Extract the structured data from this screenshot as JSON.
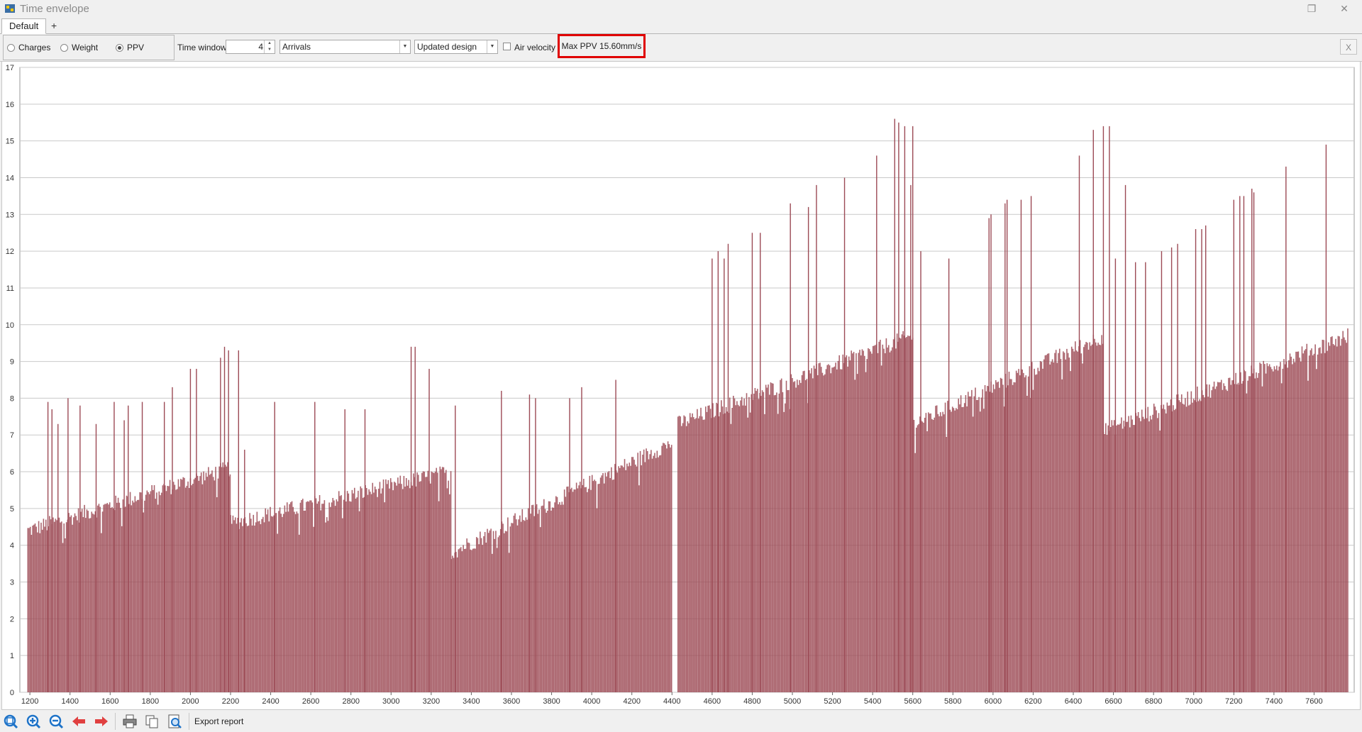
{
  "window": {
    "title": "Time envelope"
  },
  "tabs": [
    {
      "label": "Default"
    },
    {
      "label": "+"
    }
  ],
  "toolbar": {
    "radio_options": [
      {
        "label": "Charges",
        "checked": false
      },
      {
        "label": "Weight",
        "checked": false
      },
      {
        "label": "PPV",
        "checked": true
      }
    ],
    "time_window_label": "Time window",
    "time_window_value": "4",
    "source_select": "Arrivals",
    "design_select": "Updated design",
    "air_velocity_label": "Air velocity",
    "air_velocity_checked": false,
    "max_ppv": "Max PPV 15.60mm/s",
    "close_label": "X"
  },
  "bottom": {
    "export_label": "Export report"
  },
  "colors": {
    "bar": "#9c4a55",
    "highlight": "#e00000"
  },
  "icons": [
    "zoom-fit-icon",
    "zoom-in-icon",
    "zoom-out-icon",
    "arrow-left-icon",
    "arrow-right-icon",
    "print-icon",
    "copy-icon",
    "print-preview-icon"
  ],
  "chart_data": {
    "type": "bar",
    "xlim": [
      1150,
      7800
    ],
    "ylim": [
      0,
      17
    ],
    "x_ticks": [
      1200,
      1400,
      1600,
      1800,
      2000,
      2200,
      2400,
      2600,
      2800,
      3000,
      3200,
      3400,
      3600,
      3800,
      4000,
      4200,
      4400,
      4600,
      4800,
      5000,
      5200,
      5400,
      5600,
      5800,
      6000,
      6200,
      6400,
      6600,
      6800,
      7000,
      7200,
      7400,
      7600
    ],
    "y_ticks": [
      0,
      1,
      2,
      3,
      4,
      5,
      6,
      7,
      8,
      9,
      10,
      11,
      12,
      13,
      14,
      15,
      16,
      17
    ],
    "grid": true,
    "baseline_segments": [
      {
        "x": [
          1190,
          2200
        ],
        "y": [
          4.4,
          6.1
        ]
      },
      {
        "x": [
          2200,
          3300
        ],
        "y": [
          4.6,
          6.0
        ]
      },
      {
        "x": [
          3300,
          4400
        ],
        "y": [
          3.8,
          6.8
        ]
      },
      {
        "x": [
          4430,
          5600
        ],
        "y": [
          7.3,
          9.7
        ]
      },
      {
        "x": [
          5600,
          6550
        ],
        "y": [
          7.3,
          9.7
        ]
      },
      {
        "x": [
          6550,
          7770
        ],
        "y": [
          7.1,
          9.7
        ]
      }
    ],
    "spikes": [
      {
        "x": 1290,
        "y": 7.9
      },
      {
        "x": 1310,
        "y": 7.7
      },
      {
        "x": 1340,
        "y": 7.3
      },
      {
        "x": 1390,
        "y": 8.0
      },
      {
        "x": 1450,
        "y": 7.8
      },
      {
        "x": 1530,
        "y": 7.3
      },
      {
        "x": 1620,
        "y": 7.9
      },
      {
        "x": 1670,
        "y": 7.4
      },
      {
        "x": 1690,
        "y": 7.8
      },
      {
        "x": 1760,
        "y": 7.9
      },
      {
        "x": 1870,
        "y": 7.9
      },
      {
        "x": 1910,
        "y": 8.3
      },
      {
        "x": 2000,
        "y": 8.8
      },
      {
        "x": 2030,
        "y": 8.8
      },
      {
        "x": 2150,
        "y": 9.1
      },
      {
        "x": 2170,
        "y": 9.4
      },
      {
        "x": 2190,
        "y": 9.3
      },
      {
        "x": 2240,
        "y": 9.3
      },
      {
        "x": 2270,
        "y": 6.6
      },
      {
        "x": 2420,
        "y": 7.9
      },
      {
        "x": 2620,
        "y": 7.9
      },
      {
        "x": 2770,
        "y": 7.7
      },
      {
        "x": 2870,
        "y": 7.7
      },
      {
        "x": 3100,
        "y": 9.4
      },
      {
        "x": 3120,
        "y": 9.4
      },
      {
        "x": 3190,
        "y": 8.8
      },
      {
        "x": 3320,
        "y": 7.8
      },
      {
        "x": 3550,
        "y": 8.2
      },
      {
        "x": 3690,
        "y": 8.1
      },
      {
        "x": 3720,
        "y": 8.0
      },
      {
        "x": 3890,
        "y": 8.0
      },
      {
        "x": 3950,
        "y": 8.3
      },
      {
        "x": 4120,
        "y": 8.5
      },
      {
        "x": 4600,
        "y": 11.8
      },
      {
        "x": 4630,
        "y": 12.0
      },
      {
        "x": 4660,
        "y": 11.8
      },
      {
        "x": 4680,
        "y": 12.2
      },
      {
        "x": 4800,
        "y": 12.5
      },
      {
        "x": 4840,
        "y": 12.5
      },
      {
        "x": 4990,
        "y": 13.3
      },
      {
        "x": 5080,
        "y": 13.2
      },
      {
        "x": 5120,
        "y": 13.8
      },
      {
        "x": 5260,
        "y": 14.0
      },
      {
        "x": 5420,
        "y": 14.6
      },
      {
        "x": 5510,
        "y": 15.6
      },
      {
        "x": 5530,
        "y": 15.5
      },
      {
        "x": 5560,
        "y": 15.4
      },
      {
        "x": 5590,
        "y": 13.8
      },
      {
        "x": 5600,
        "y": 15.4
      },
      {
        "x": 5640,
        "y": 12.0
      },
      {
        "x": 5780,
        "y": 11.8
      },
      {
        "x": 5980,
        "y": 12.9
      },
      {
        "x": 5990,
        "y": 13.0
      },
      {
        "x": 6060,
        "y": 13.3
      },
      {
        "x": 6070,
        "y": 13.4
      },
      {
        "x": 6140,
        "y": 13.4
      },
      {
        "x": 6190,
        "y": 13.5
      },
      {
        "x": 6430,
        "y": 14.6
      },
      {
        "x": 6500,
        "y": 15.3
      },
      {
        "x": 6550,
        "y": 15.4
      },
      {
        "x": 6580,
        "y": 15.4
      },
      {
        "x": 6610,
        "y": 11.8
      },
      {
        "x": 6660,
        "y": 13.8
      },
      {
        "x": 6710,
        "y": 11.7
      },
      {
        "x": 6760,
        "y": 11.7
      },
      {
        "x": 6840,
        "y": 12.0
      },
      {
        "x": 6890,
        "y": 12.1
      },
      {
        "x": 6920,
        "y": 12.2
      },
      {
        "x": 7010,
        "y": 12.6
      },
      {
        "x": 7040,
        "y": 12.6
      },
      {
        "x": 7060,
        "y": 12.7
      },
      {
        "x": 7200,
        "y": 13.4
      },
      {
        "x": 7230,
        "y": 13.5
      },
      {
        "x": 7250,
        "y": 13.5
      },
      {
        "x": 7290,
        "y": 13.7
      },
      {
        "x": 7300,
        "y": 13.6
      },
      {
        "x": 7460,
        "y": 14.3
      },
      {
        "x": 7660,
        "y": 14.9
      }
    ]
  }
}
